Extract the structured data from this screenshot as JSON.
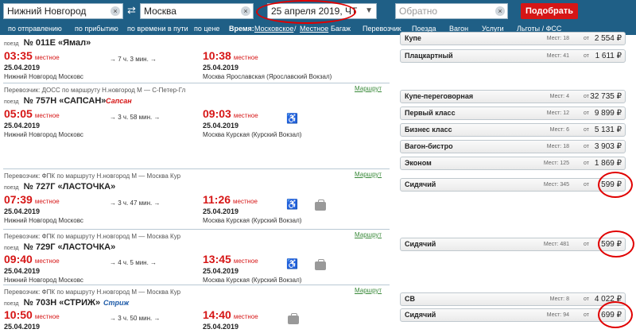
{
  "search": {
    "from": "Нижний Новгород",
    "to": "Москва",
    "date": "25 апреля 2019, ЧТ",
    "back_placeholder": "Обратно",
    "submit": "Подобрать",
    "swap_icon": "⇄",
    "clear_icon": "×",
    "date_dropdown_icon": "▼"
  },
  "sort_bar": {
    "by_departure": "по отправлению",
    "by_arrival": "по прибытию",
    "by_travel_time": "по времени в пути",
    "by_price": "по цене",
    "time_label": "Время:",
    "time_moscow": "Московское",
    "time_slash": "/",
    "time_local": "Местное",
    "filters": [
      "Багаж",
      "Перевозчик",
      "Поезда",
      "Вагон",
      "Услуги",
      "Льготы / ФСС"
    ]
  },
  "common": {
    "train_prefix": "поезд",
    "local": "местное",
    "route_link": "Маршрут",
    "seats_label": "Мест:",
    "from_label": "от",
    "arrow": "→",
    "wheelchair_icon": "♿"
  },
  "trains": [
    {
      "number": "№ 011Е «Ямал»",
      "carrier": "",
      "dep_time": "03:35",
      "dep_date": "25.04.2019",
      "dep_station": "Нижний Новгород Московс",
      "duration": "7 ч. 3 мин.",
      "arr_time": "10:38",
      "arr_date": "25.04.2019",
      "arr_station": "Москва Ярославская (Ярославский Вокзал)",
      "cars": [
        {
          "cls": "Купе",
          "seats": "18",
          "price": "2 554 ₽"
        },
        {
          "cls": "Плацкартный",
          "seats": "41",
          "price": "1 611 ₽"
        }
      ]
    },
    {
      "number": "№ 757Н «САПСАН»",
      "logo": "Сапсан",
      "carrier": "Перевозчик: ДОСС  по маршруту Н.новгород М — С-Петер-Гл",
      "dep_time": "05:05",
      "dep_date": "25.04.2019",
      "dep_station": "Нижний Новгород Московс",
      "duration": "3 ч. 58 мин.",
      "arr_time": "09:03",
      "arr_date": "25.04.2019",
      "arr_station": "Москва Курская (Курский Вокзал)",
      "cars": [
        {
          "cls": "Купе-переговорная",
          "seats": "4",
          "price": "32 735 ₽"
        },
        {
          "cls": "Первый класс",
          "seats": "12",
          "price": "9 899 ₽"
        },
        {
          "cls": "Бизнес класс",
          "seats": "6",
          "price": "5 131 ₽"
        },
        {
          "cls": "Вагон-бистро",
          "seats": "18",
          "price": "3 903 ₽"
        },
        {
          "cls": "Эконом",
          "seats": "125",
          "price": "1 869 ₽"
        }
      ]
    },
    {
      "number": "№ 727Г «ЛАСТОЧКА»",
      "carrier": "Перевозчик: ФПК  по маршруту Н.новгород М — Москва Кур",
      "dep_time": "07:39",
      "dep_date": "25.04.2019",
      "dep_station": "Нижний Новгород Московс",
      "duration": "3 ч. 47 мин.",
      "arr_time": "11:26",
      "arr_date": "25.04.2019",
      "arr_station": "Москва Курская (Курский Вокзал)",
      "cars": [
        {
          "cls": "Сидячий",
          "seats": "345",
          "price": "599 ₽"
        }
      ]
    },
    {
      "number": "№ 729Г «ЛАСТОЧКА»",
      "carrier": "Перевозчик: ФПК  по маршруту Н.новгород М — Москва Кур",
      "dep_time": "09:40",
      "dep_date": "25.04.2019",
      "dep_station": "Нижний Новгород Московс",
      "duration": "4 ч. 5 мин.",
      "arr_time": "13:45",
      "arr_date": "25.04.2019",
      "arr_station": "Москва Курская (Курский Вокзал)",
      "cars": [
        {
          "cls": "Сидячий",
          "seats": "481",
          "price": "599 ₽"
        }
      ]
    },
    {
      "number": "№ 703Н «СТРИЖ»",
      "logo": "Стриж",
      "carrier": "Перевозчик: ФПК  по маршруту Н.новгород М — Москва Кур",
      "dep_time": "10:50",
      "dep_date": "25.04.2019",
      "dep_station": "",
      "duration": "3 ч. 50 мин.",
      "arr_time": "14:40",
      "arr_date": "25.04.2019",
      "arr_station": "",
      "cars": [
        {
          "cls": "СВ",
          "seats": "8",
          "price": "4 022 ₽"
        },
        {
          "cls": "Сидячий",
          "seats": "94",
          "price": "699 ₽"
        }
      ]
    }
  ]
}
